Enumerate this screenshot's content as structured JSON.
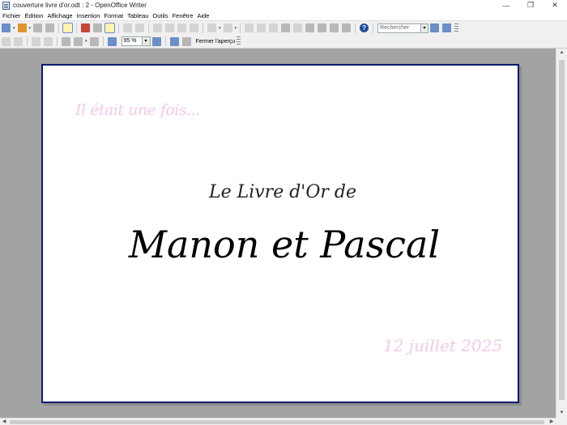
{
  "window": {
    "title": "couverture livre d'or.odt : 2 - OpenOffice Writer",
    "minimize_glyph": "—",
    "maximize_glyph": "❐",
    "close_glyph": "✕"
  },
  "menu": {
    "items": [
      "Fichier",
      "Édition",
      "Affichage",
      "Insertion",
      "Format",
      "Tableau",
      "Outils",
      "Fenêtre",
      "Aide"
    ]
  },
  "toolbar": {
    "search_placeholder": "Rechercher",
    "help_glyph": "?",
    "dropdown_glyph": "▾"
  },
  "preview_toolbar": {
    "zoom_value": "95 %",
    "close_preview_label": "Fermer l'aperçu"
  },
  "document": {
    "intro_text": "Il était une fois...",
    "title_line": "Le Livre d'Or de",
    "names": "Manon et Pascal",
    "date": "12 juillet 2025",
    "colors": {
      "page_border": "#0b1a6e",
      "pink_text": "#f3c9e9",
      "workspace": "#a3a3a3"
    }
  },
  "scrollbars": {
    "up_glyph": "▲",
    "down_glyph": "▼",
    "left_glyph": "◀",
    "right_glyph": "▶"
  }
}
